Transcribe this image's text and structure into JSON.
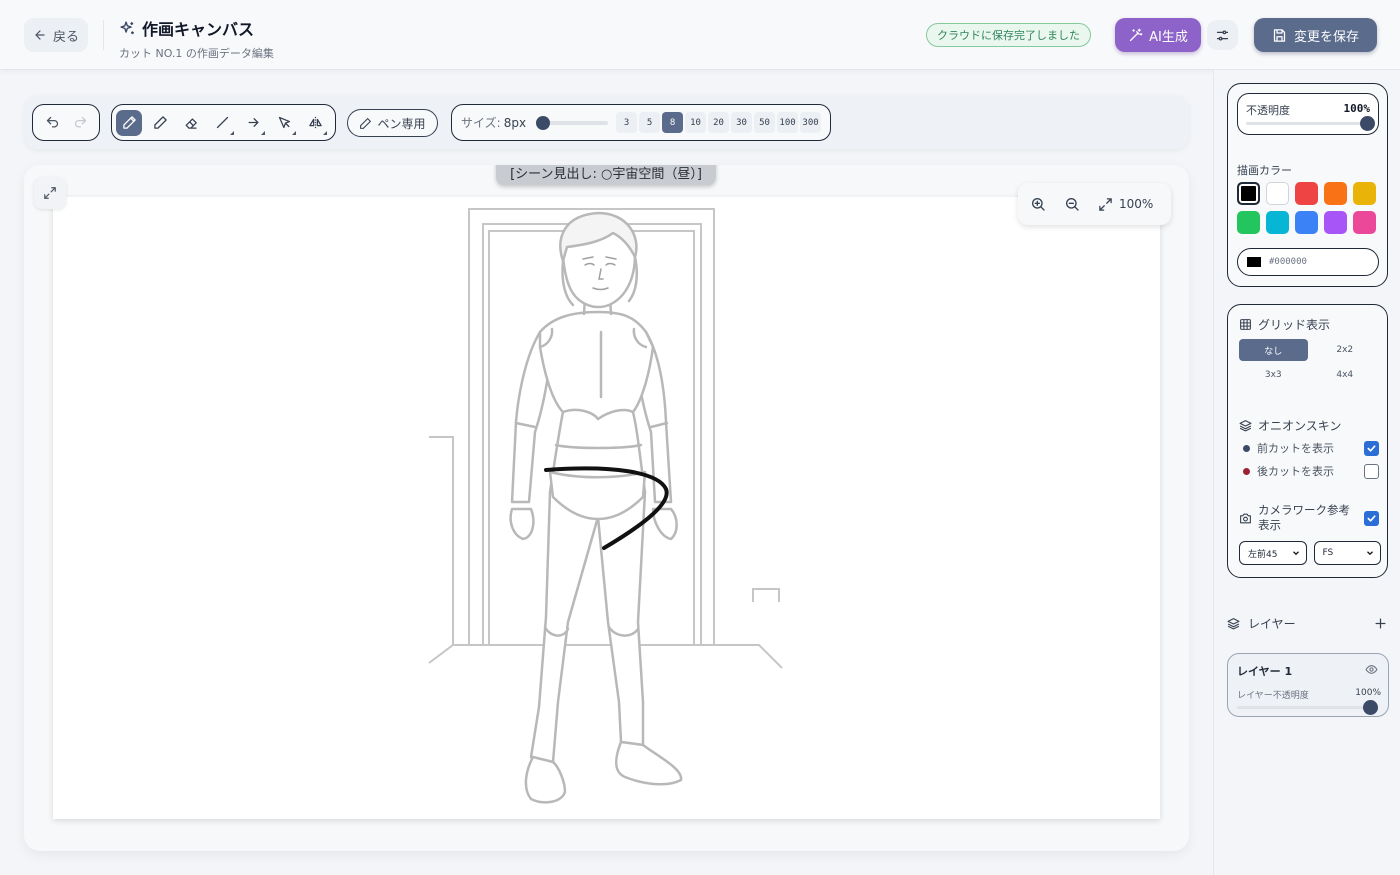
{
  "header": {
    "back_label": "戻る",
    "title": "作画キャンバス",
    "subtitle": "カット NO.1 の作画データ編集",
    "save_status": "クラウドに保存完了しました",
    "ai_label": "AI生成",
    "save_label": "変更を保存"
  },
  "toolbar": {
    "tools": [
      "pen-icon",
      "pencil-icon",
      "eraser-icon",
      "line-icon",
      "arrow-icon",
      "select-icon",
      "flip-icon"
    ],
    "active_tool": "pen",
    "pen_only_label": "ペン専用",
    "size_label": "サイズ:",
    "size_value": "8px",
    "size_presets": [
      "3",
      "5",
      "8",
      "10",
      "20",
      "30",
      "50",
      "100",
      "300"
    ],
    "active_preset": "8"
  },
  "canvas": {
    "scene_label": "[シーン見出し: ○宇宙空間（昼）]",
    "zoom": "100%"
  },
  "sidebar": {
    "opacity": {
      "label": "不透明度",
      "value": "100%",
      "level": 1.0
    },
    "draw_color": {
      "label": "描画カラー",
      "swatches": [
        "#000000",
        "#ffffff",
        "#ef4444",
        "#f97316",
        "#eab308",
        "#22c55e",
        "#06b6d4",
        "#3b82f6",
        "#a855f7",
        "#ec4899"
      ],
      "selected": "#000000",
      "hex": "#000000"
    },
    "grid": {
      "label": "グリッド表示",
      "options": [
        "なし",
        "2x2",
        "3x3",
        "4x4"
      ],
      "selected": "なし"
    },
    "onion": {
      "label": "オニオンスキン",
      "prev_label": "前カットを表示",
      "prev_checked": true,
      "prev_color": "#3b4a66",
      "next_label": "後カットを表示",
      "next_checked": false,
      "next_color": "#9b2335"
    },
    "camera": {
      "label": "カメラワーク参考表示",
      "checked": true,
      "angle": "左前45",
      "shot": "FS"
    },
    "layers": {
      "label": "レイヤー",
      "items": [
        {
          "name": "レイヤー 1",
          "opacity_label": "レイヤー不透明度",
          "opacity": "100%",
          "level": 1.0
        }
      ]
    }
  }
}
